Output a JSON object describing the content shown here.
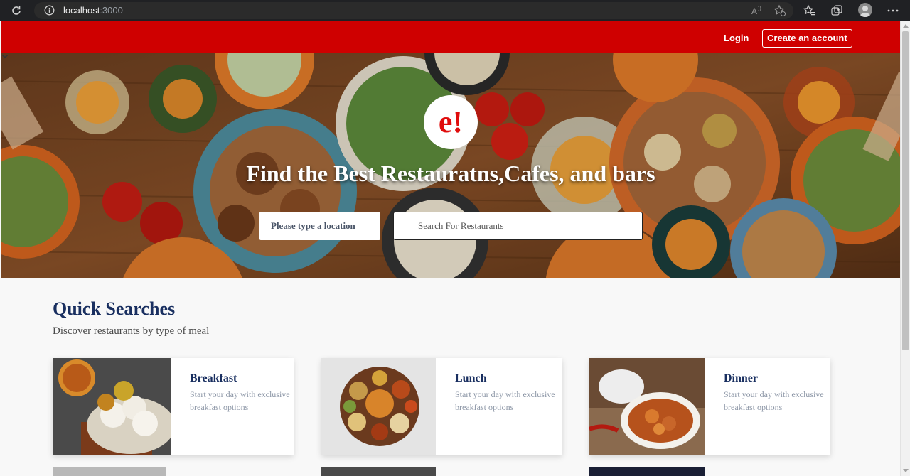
{
  "browser": {
    "url_host": "localhost",
    "url_port": ":3000"
  },
  "nav": {
    "login_label": "Login",
    "signup_label": "Create an account"
  },
  "hero": {
    "logo_text": "e!",
    "title": "Find the Best Restauratns,Cafes, and bars",
    "location_placeholder": "Please type a location",
    "search_placeholder": "Search For Restaurants"
  },
  "quick_searches": {
    "title": "Quick Searches",
    "subtitle": "Discover restaurants by type of meal",
    "cards": [
      {
        "title": "Breakfast",
        "desc": "Start your day with exclusive breakfast options"
      },
      {
        "title": "Lunch",
        "desc": "Start your day with exclusive breakfast options"
      },
      {
        "title": "Dinner",
        "desc": "Start your day with exclusive breakfast options"
      }
    ]
  },
  "colors": {
    "brand_red": "#cf0000",
    "heading_navy": "#192f60"
  }
}
